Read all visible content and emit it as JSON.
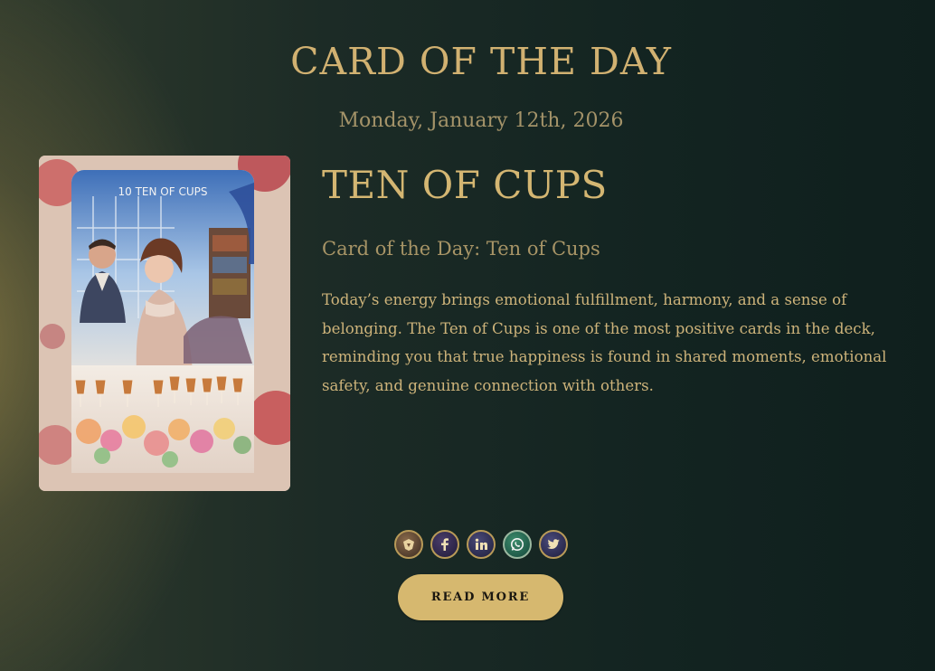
{
  "header": {
    "title": "CARD OF THE DAY",
    "date": "Monday, January 12th, 2026"
  },
  "card": {
    "name": "TEN OF CUPS",
    "image_label": "10 TEN OF CUPS",
    "subtitle": "Card of the Day: Ten of Cups",
    "description": "Today’s energy brings emotional fulfillment, harmony, and a sense of belonging. The Ten of Cups is one of the most positive cards in the deck, reminding you that true happiness is found in shared moments, emotional safety, and genuine connection with others."
  },
  "share": {
    "icons": [
      {
        "name": "brand-logo-icon",
        "glyph": "✦"
      },
      {
        "name": "facebook-icon",
        "glyph": "f"
      },
      {
        "name": "linkedin-icon",
        "glyph": "in"
      },
      {
        "name": "whatsapp-icon",
        "glyph": "✆"
      },
      {
        "name": "twitter-icon",
        "glyph": "🐦"
      }
    ]
  },
  "actions": {
    "read_more_label": "READ MORE"
  },
  "colors": {
    "accent_gold": "#d6b86f",
    "title_gold": "#d1b171",
    "muted_gold": "#a49369",
    "background_dark": "#132421"
  }
}
